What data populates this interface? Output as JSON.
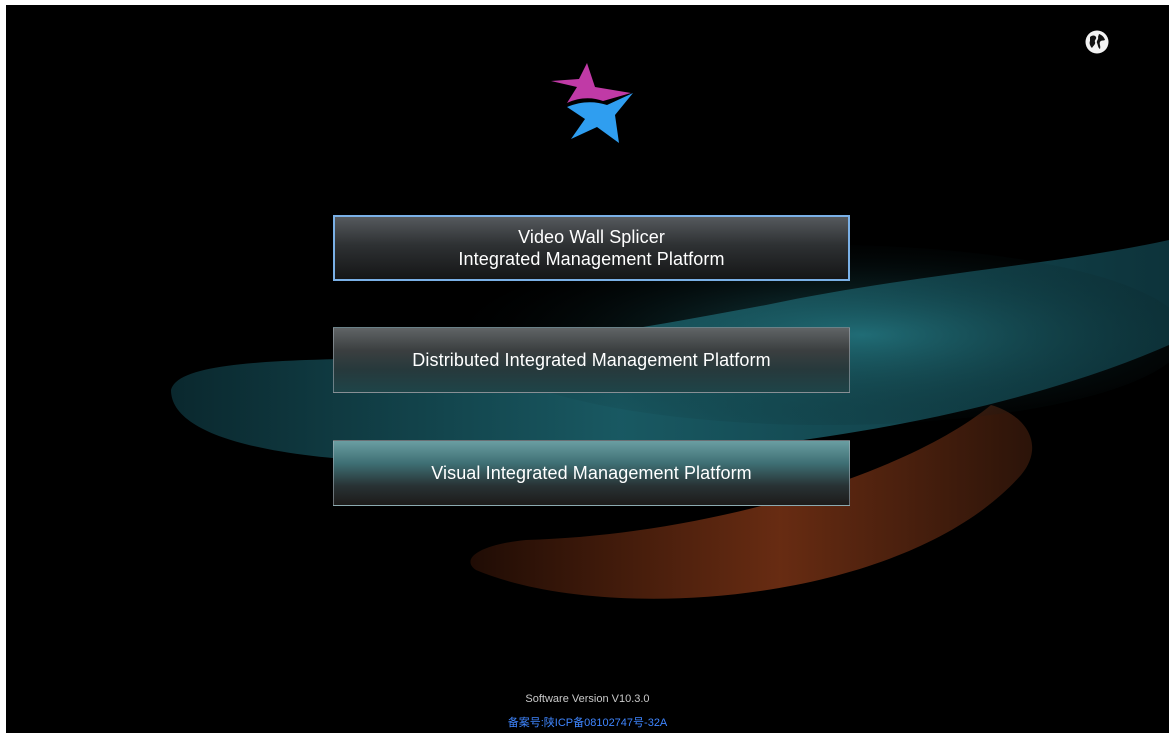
{
  "buttons": {
    "video_wall_line1": "Video Wall Splicer",
    "video_wall_line2": "Integrated Management Platform",
    "distributed": "Distributed Integrated Management Platform",
    "visual": "Visual Integrated Management Platform"
  },
  "footer": {
    "version": "Software Version V10.3.0",
    "icp": "备案号:陕ICP备08102747号-32A"
  },
  "icons": {
    "language": "globe-icon",
    "logo": "star-logo"
  },
  "colors": {
    "background": "#000000",
    "logo_magenta": "#c03aa6",
    "logo_blue": "#2f9ef0",
    "swoosh_teal": "#1f6e78",
    "swoosh_orange": "#a8491f",
    "selected_border": "#7ab0e6",
    "icp_link": "#3f86ff"
  }
}
